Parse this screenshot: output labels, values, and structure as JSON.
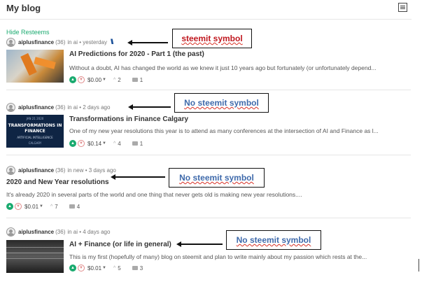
{
  "header": {
    "title": "My blog"
  },
  "hide_resteems": "Hide Resteems",
  "posts": [
    {
      "author": "aiplusfinance",
      "reputation": "(36)",
      "meta": "in ai • yesterday",
      "has_steemit_symbol": true,
      "steemit_icon": "steemit-logo",
      "title": "AI Predictions for 2020 - Part 1 (the past)",
      "excerpt": "Without a doubt, AI has changed the world as we knew it just 10 years ago but fortunately (or unfortunately depend...",
      "payout": "$0.00",
      "votes": "2",
      "comments": "1",
      "thumbnail": "robot-arm"
    },
    {
      "author": "aiplusfinance",
      "reputation": "(36)",
      "meta": "in ai • 2 days ago",
      "has_steemit_symbol": false,
      "title": "Transformations in Finance Calgary",
      "excerpt": "One of my new year resolutions this year is to attend as many conferences at the intersection of AI and Finance as l...",
      "payout": "$0.14",
      "votes": "4",
      "comments": "1",
      "thumbnail": "transformations-banner",
      "thumbnail_text": {
        "line1": "JAN 21 2020",
        "line2": "TRANSFORMATIONS IN",
        "line3": "FINANCE",
        "line4": "ARTIFICIAL INTELLIGENCE",
        "line5": "CALGARY"
      }
    },
    {
      "author": "aiplusfinance",
      "reputation": "(36)",
      "meta": "in new • 3 days ago",
      "has_steemit_symbol": false,
      "title": "2020 and New Year resolutions",
      "excerpt": "It's already 2020 in several parts of the world and one thing that never gets old is making new year resolutions....",
      "payout": "$0.01",
      "votes": "7",
      "comments": "4",
      "thumbnail": null
    },
    {
      "author": "aiplusfinance",
      "reputation": "(36)",
      "meta": "in ai • 4 days ago",
      "has_steemit_symbol": false,
      "title": "AI + Finance (or life in general)",
      "excerpt": "This is my first (hopefully of many) blog on steemit and plan to write mainly about my passion which rests at the...",
      "payout": "$0.01",
      "votes": "5",
      "comments": "3",
      "thumbnail": "stock-chart"
    }
  ],
  "annotations": [
    {
      "text": "steemit symbol",
      "color": "#c0181f"
    },
    {
      "text": "No steemit symbol",
      "color": "#3f6aab"
    },
    {
      "text": "No steemit symbol",
      "color": "#3f6aab"
    },
    {
      "text": "No steemit symbol",
      "color": "#3f6aab"
    }
  ],
  "colors": {
    "accent_green": "#1aaa6f",
    "downvote_red": "#e08a8a",
    "annotation_red": "#c0181f",
    "annotation_blue": "#3f6aab"
  }
}
